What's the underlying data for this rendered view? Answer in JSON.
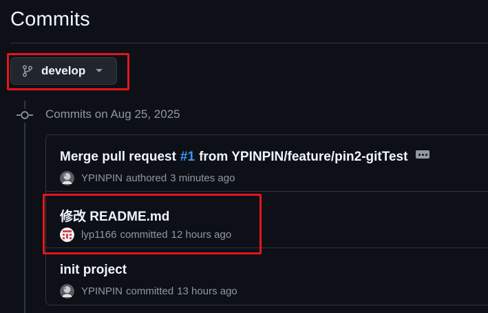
{
  "page": {
    "title": "Commits"
  },
  "branch": {
    "name": "develop"
  },
  "group": {
    "heading": "Commits on Aug 25, 2025"
  },
  "commits": [
    {
      "title_prefix": "Merge pull request",
      "title_link": "#1",
      "title_suffix": "from YPINPIN/feature/pin2-gitTest",
      "author": "YPINPIN",
      "action": "authored",
      "time": "3 minutes ago",
      "avatar_icon": "ypinpin-avatar"
    },
    {
      "title": "修改 README.md",
      "author": "lyp1166",
      "action": "committed",
      "time": "12 hours ago",
      "avatar_icon": "lyp1166-avatar"
    },
    {
      "title": "init project",
      "author": "YPINPIN",
      "action": "committed",
      "time": "13 hours ago",
      "avatar_icon": "ypinpin-avatar"
    }
  ],
  "colors": {
    "background": "#0d1117",
    "link": "#4493f8",
    "highlight": "#e8141c",
    "muted_text": "#9198a1"
  }
}
